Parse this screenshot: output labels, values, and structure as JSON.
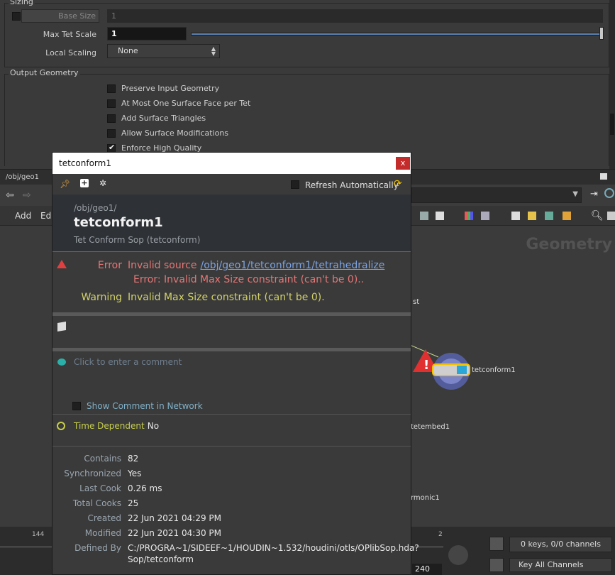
{
  "params": {
    "sizing_title": "Sizing",
    "base_size_label": "Base Size",
    "base_size_value": "1",
    "max_tet_scale_label": "Max Tet Scale",
    "max_tet_scale_value": "1",
    "local_scaling_label": "Local Scaling",
    "local_scaling_value": "None",
    "output_title": "Output Geometry",
    "checkboxes": [
      {
        "label": "Preserve Input Geometry",
        "checked": false
      },
      {
        "label": "At Most One Surface Face per Tet",
        "checked": false
      },
      {
        "label": "Add Surface Triangles",
        "checked": false
      },
      {
        "label": "Allow Surface Modifications",
        "checked": false
      },
      {
        "label": "Enforce High Quality",
        "checked": true
      }
    ]
  },
  "network": {
    "tab_label": "/obj/geo1",
    "menu_add": "Add",
    "menu_edit": "Edi",
    "watermark": "Geometry",
    "nodes": {
      "tetconform": "tetconform1",
      "tetembed": "tetembed1",
      "harmonic": "rmonic1",
      "partial_st": "st"
    }
  },
  "timeline": {
    "frame_left": "144",
    "frame_right": "2",
    "end_frame": "240",
    "keys_label": "0 keys, 0/0 channels",
    "key_all_label": "Key All Channels"
  },
  "popup": {
    "title": "tetconform1",
    "close_glyph": "x",
    "refresh_label": "Refresh Automatically",
    "path": "/obj/geo1/",
    "name": "tetconform1",
    "type": "Tet Conform Sop (tetconform)",
    "error_key": "Error",
    "error_prefix": "Invalid source ",
    "error_link": "/obj/geo1/tetconform1/tetrahedralize",
    "error_detail": "Error: Invalid Max Size constraint (can't be 0)..",
    "warning_key": "Warning",
    "warning_text": "Invalid Max Size constraint (can't be 0).",
    "comment_placeholder": "Click to enter a comment",
    "show_comment_label": "Show Comment in Network",
    "time_dep_key": "Time Dependent",
    "time_dep_value": "No",
    "stats": [
      {
        "key": "Contains",
        "value": "82"
      },
      {
        "key": "Synchronized",
        "value": "Yes"
      },
      {
        "key": "Last Cook",
        "value": "0.26 ms"
      },
      {
        "key": "Total Cooks",
        "value": "25"
      },
      {
        "key": "Created",
        "value": "22 Jun 2021 04:29 PM"
      },
      {
        "key": "Modified",
        "value": "22 Jun 2021 04:30 PM"
      },
      {
        "key": "Defined By",
        "value": "C:/PROGRA~1/SIDEEF~1/HOUDIN~1.532/houdini/otls/OPlibSop.hda?"
      },
      {
        "key": "",
        "value": "Sop/tetconform"
      }
    ]
  },
  "colors": {
    "error": "#e57676",
    "warning": "#d2d26a",
    "link": "#7da3e2",
    "slider": "#5a83b6",
    "close": "#c42b2b"
  }
}
